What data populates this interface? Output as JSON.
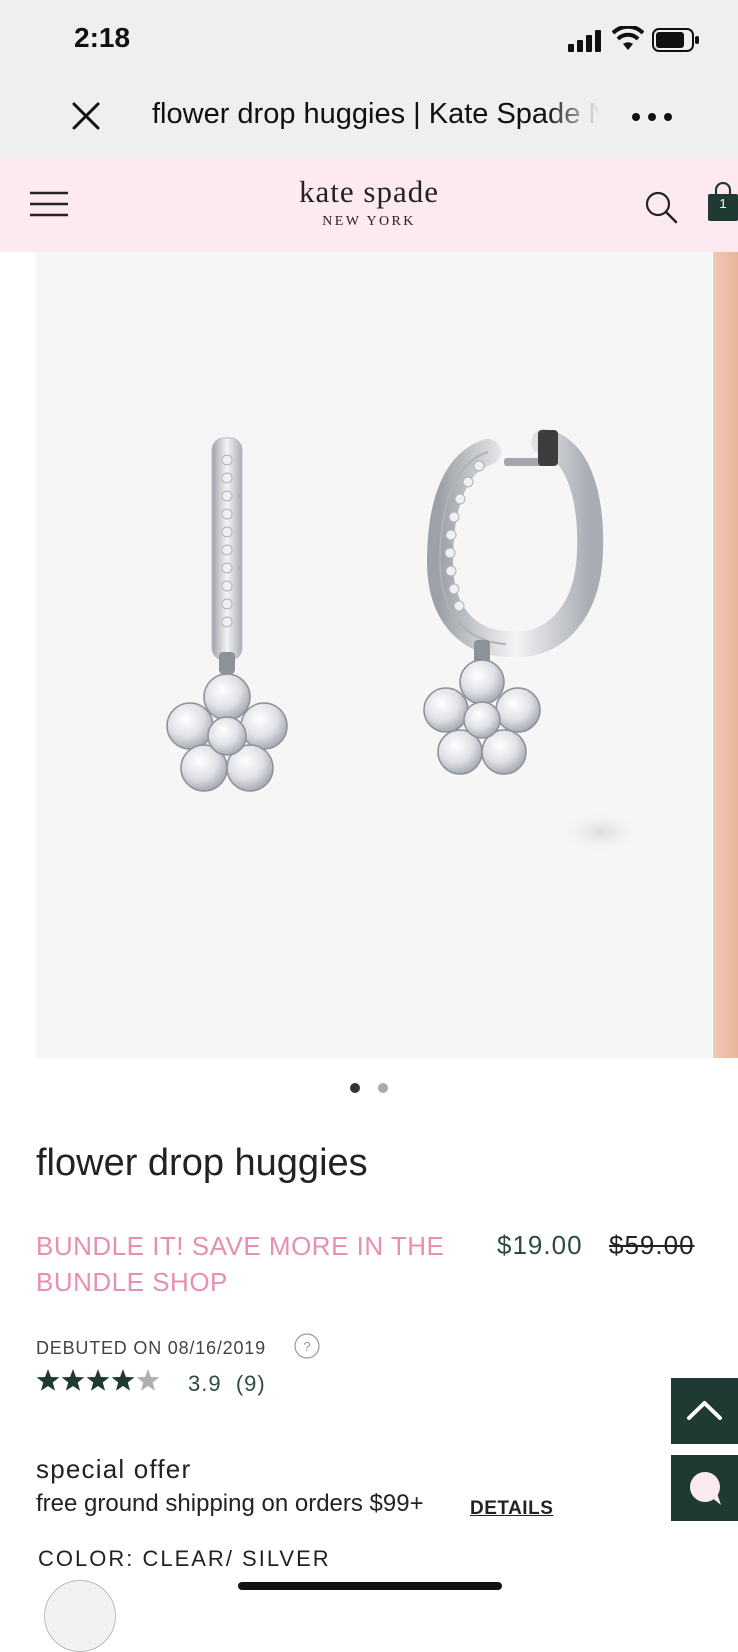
{
  "status_bar": {
    "time": "2:18"
  },
  "browser": {
    "title": "flower drop huggies | Kate Spade New York"
  },
  "header": {
    "logo_main": "kate spade",
    "logo_sub": "NEW YORK",
    "bag_count": "1"
  },
  "gallery": {
    "dots": [
      {
        "active": true
      },
      {
        "active": false
      }
    ]
  },
  "product": {
    "name": "flower drop huggies",
    "promo": "BUNDLE IT! SAVE MORE IN THE BUNDLE SHOP",
    "sale_price": "$19.00",
    "original_price": "$59.00",
    "debut": "DEBUTED ON 08/16/2019",
    "rating_value": "3.9",
    "rating_count": "(9)",
    "stars_filled": 4,
    "stars_total": 5
  },
  "offer": {
    "title": "special offer",
    "text": "free ground shipping on orders $99+",
    "link": "DETAILS"
  },
  "color": {
    "label": "COLOR: CLEAR/ SILVER"
  },
  "colors": {
    "accent_pink": "#e78fb3",
    "dark_green": "#1f3a33",
    "header_pink": "#fde9f0",
    "price_green": "#2f4a44"
  }
}
